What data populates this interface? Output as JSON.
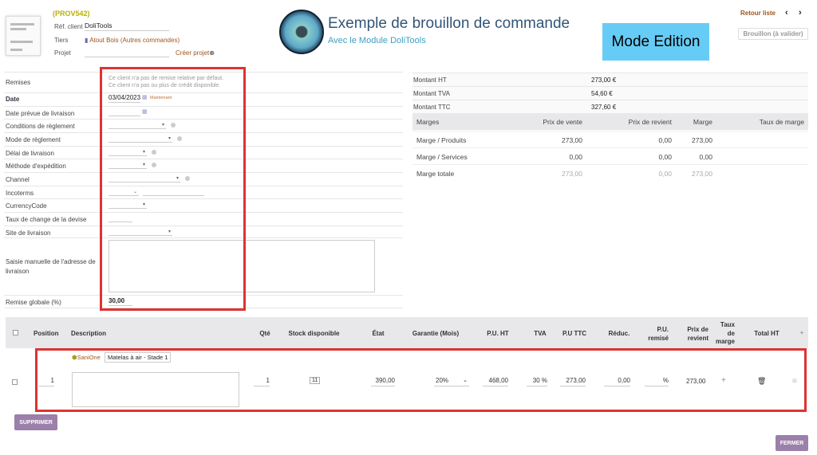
{
  "header": {
    "ref": "(PROV542)",
    "ref_client_label": "Réf. client",
    "ref_client": "DoliTools",
    "tiers_label": "Tiers",
    "tiers": "Atout Bois (Autres commandes)",
    "projet_label": "Projet",
    "create_project": "Créer projet",
    "retour_liste": "Retour liste",
    "status": "Brouillon (à valider)"
  },
  "banner": {
    "title": "Exemple de brouillon de commande",
    "subtitle": "Avec le Module DoliTools",
    "mode": "Mode Edition"
  },
  "form": {
    "remises_label": "Remises",
    "remise_line1": "Ce client n'a pas de remise relative par défaut.",
    "remise_line2": "Ce client n'a pas ou plus de crédit disponible.",
    "date_label": "Date",
    "date": "03/04/2023",
    "now": "Maintenant",
    "labels": [
      "Date prévue de livraison",
      "Conditions de règlement",
      "Mode de règlement",
      "Délai de livraison",
      "Méthode d'expédition",
      "Channel",
      "Incoterms",
      "CurrencyCode",
      "Taux de change de la devise",
      "Site de livraison"
    ],
    "address_label": "Saisie manuelle de l'adresse de livraison",
    "remise_globale_label": "Remise globale (%)",
    "remise_globale": "30,00"
  },
  "totals": {
    "ht_label": "Montant HT",
    "ht": "273,00 €",
    "tva_label": "Montant TVA",
    "tva": "54,60 €",
    "ttc_label": "Montant TTC",
    "ttc": "327,60 €"
  },
  "margins": {
    "headers": [
      "Marges",
      "Prix de vente",
      "Prix de revient",
      "Marge",
      "Taux de marge"
    ],
    "rows": [
      [
        "Marge / Produits",
        "273,00",
        "0,00",
        "273,00",
        ""
      ],
      [
        "Marge / Services",
        "0,00",
        "0,00",
        "0,00",
        ""
      ],
      [
        "Marge totale",
        "273,00",
        "0,00",
        "273,00",
        ""
      ]
    ]
  },
  "lines": {
    "headers": [
      "Position",
      "Description",
      "Qté",
      "Stock disponible",
      "État",
      "Garantie (Mois)",
      "P.U. HT",
      "TVA",
      "P.U TTC",
      "Réduc.",
      "P.U. remisé",
      "Prix de revient",
      "Taux de marge",
      "Total HT",
      "+"
    ],
    "row": {
      "position": "1",
      "product_ref": "SaniOne",
      "product_label": "Matelas à air - Stade 1",
      "qty": "1",
      "stock": "11",
      "etat": "390,00",
      "garantie": "20%",
      "pu_ht": "468,00",
      "tva": "30 %",
      "pu_ttc": "273,00",
      "reduc": "0,00",
      "pu_remise": "%",
      "prix_revient": "273,00",
      "marge_add": "+"
    }
  },
  "buttons": {
    "supprimer": "SUPPRIMER",
    "fermer": "FERMER"
  }
}
